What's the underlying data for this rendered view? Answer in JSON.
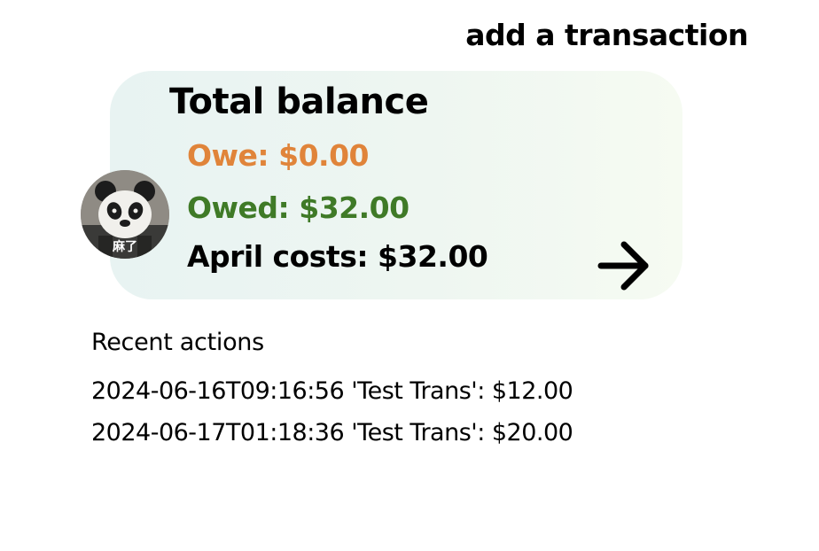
{
  "header": {
    "add_transaction_label": "add a transaction"
  },
  "balance_card": {
    "title": "Total balance",
    "owe": "Owe: $0.00",
    "owed": "Owed: $32.00",
    "month_costs": "April costs: $32.00",
    "arrow_icon": "arrow-right-icon"
  },
  "avatar": {
    "caption": "麻了"
  },
  "recent": {
    "title": "Recent actions",
    "items": [
      "2024-06-16T09:16:56 'Test Trans': $12.00",
      "2024-06-17T01:18:36 'Test Trans': $20.00"
    ]
  },
  "colors": {
    "owe": "#e0843a",
    "owed": "#3f7a27",
    "text": "#000000",
    "card_gradient_start": "#e8f3f2",
    "card_gradient_end": "#f6fbf2"
  }
}
